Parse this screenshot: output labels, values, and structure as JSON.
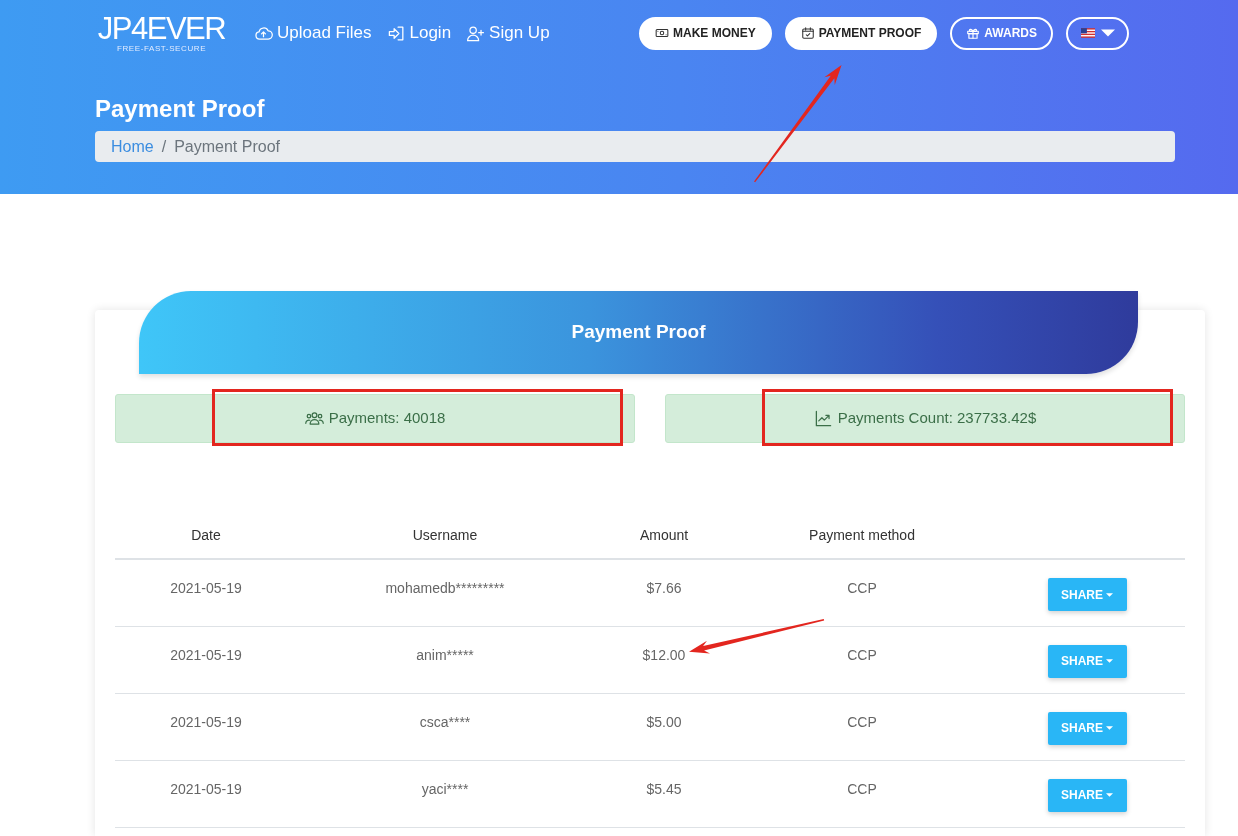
{
  "header": {
    "logo": {
      "wordmark": "JP4EVER",
      "tagline": "FREE-FAST-SECURE"
    },
    "nav_links": [
      {
        "label": "Upload Files"
      },
      {
        "label": "Login"
      },
      {
        "label": "Sign Up"
      }
    ],
    "nav_buttons": [
      {
        "label": "MAKE MONEY",
        "kind": "solid",
        "annotated": false
      },
      {
        "label": "PAYMENT PROOF",
        "kind": "solid",
        "annotated": true
      },
      {
        "label": "AWARDS",
        "kind": "outline",
        "annotated": false
      }
    ],
    "page_title": "Payment Proof",
    "breadcrumb": {
      "separator": "/",
      "items": [
        {
          "label": "Home",
          "kind": "link"
        },
        {
          "label": "Payment Proof",
          "kind": "current"
        }
      ]
    }
  },
  "card": {
    "title": "Payment Proof",
    "stats": [
      {
        "label": "Payments: 40018",
        "annotated": true
      },
      {
        "label": "Payments Count: 237733.42$",
        "annotated": true
      }
    ],
    "table": {
      "columns": [
        "Date",
        "Username",
        "Amount",
        "Payment method"
      ],
      "rows": [
        {
          "cells": [
            "2021-05-19",
            "mohamedb*********",
            "$7.66",
            "CCP"
          ],
          "action": "SHARE",
          "annotated": false
        },
        {
          "cells": [
            "2021-05-19",
            "anim*****",
            "$12.00",
            "CCP"
          ],
          "action": "SHARE",
          "annotated": true
        },
        {
          "cells": [
            "2021-05-19",
            "csca****",
            "$5.00",
            "CCP"
          ],
          "action": "SHARE",
          "annotated": false
        },
        {
          "cells": [
            "2021-05-19",
            "yaci****",
            "$5.45",
            "CCP"
          ],
          "action": "SHARE",
          "annotated": false
        }
      ]
    }
  }
}
